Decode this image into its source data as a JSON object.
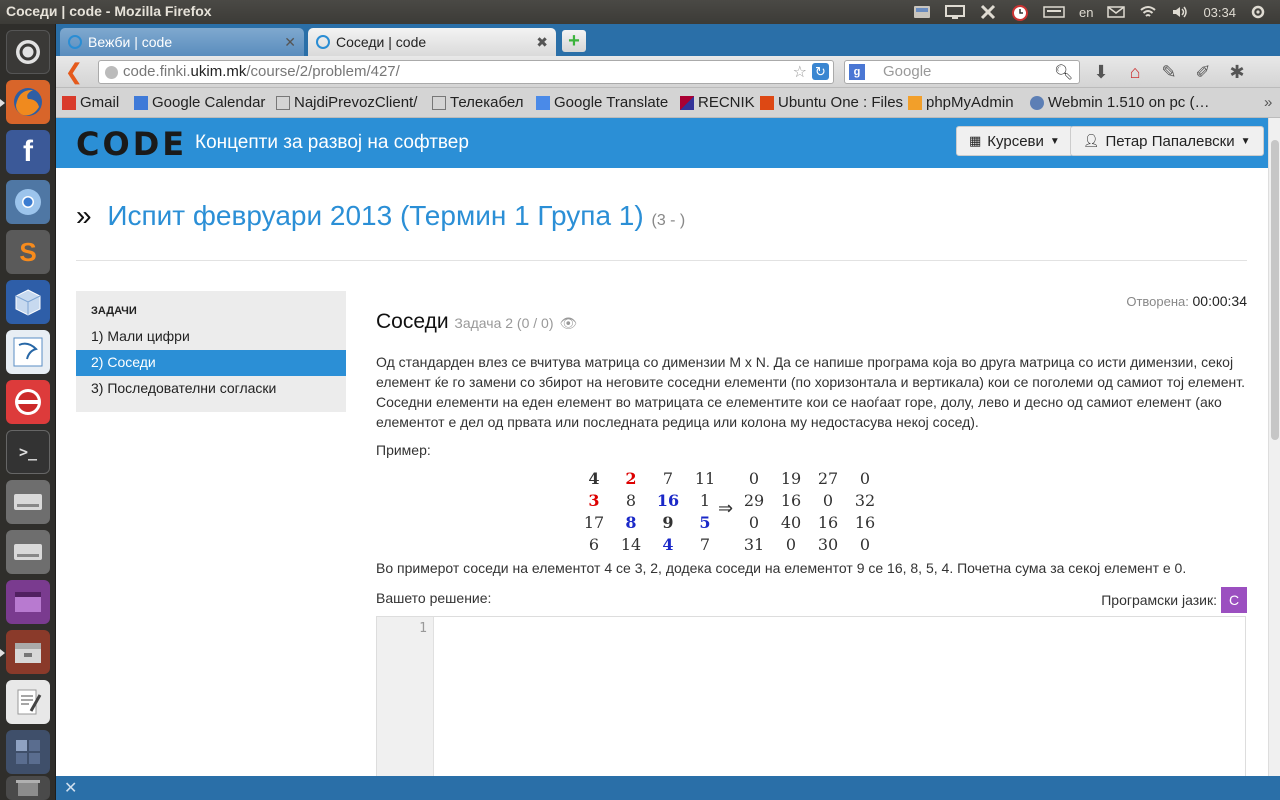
{
  "top_panel": {
    "window_title": "Соседи | code - Mozilla Firefox",
    "keyboard_layout": "en",
    "clock": "03:34"
  },
  "launcher": {
    "items": [
      "ubuntu-icon",
      "firefox-icon",
      "facebook-icon",
      "chromium-icon",
      "sublime-icon",
      "virtualbox-icon",
      "mysql-workbench-icon",
      "eclipse-icon",
      "terminal-icon",
      "drive-icon",
      "drive-icon-2",
      "app-window-icon",
      "file-manager-icon",
      "text-editor-icon",
      "workspace-switcher-icon",
      "trash-icon"
    ]
  },
  "browser": {
    "tabs": [
      {
        "label": "Вежби | code"
      },
      {
        "label": "Соседи | code"
      }
    ],
    "url": {
      "prefix": "code.finki.",
      "host": "ukim.mk",
      "path": "/course/2/problem/427/"
    },
    "search_placeholder": "Google",
    "search_engine_badge": "g",
    "bookmarks": [
      {
        "label": "Gmail"
      },
      {
        "label": "Google Calendar"
      },
      {
        "label": "NajdiPrevozClient/"
      },
      {
        "label": "Телекабел"
      },
      {
        "label": "Google Translate"
      },
      {
        "label": "RECNIK"
      },
      {
        "label": "Ubuntu One : Files"
      },
      {
        "label": "phpMyAdmin"
      },
      {
        "label": "Webmin 1.510 on pc (…"
      }
    ]
  },
  "site": {
    "logo": "CODE",
    "title": "Концепти за развој на софтвер",
    "courses_btn": "Курсеви",
    "user_btn": "Петар Папалевски",
    "page_title": "Испит февруари 2013 (Термин 1 Група 1)",
    "page_title_sub": "(3 - )",
    "sidebar_head": "ЗАДАЧИ",
    "sidebar_items": [
      "1) Мали цифри",
      "2) Соседи",
      "3) Последователни согласки"
    ],
    "opened_label": "Отворена:",
    "opened_time": "00:00:34",
    "problem_title": "Соседи",
    "problem_meta": "Задача 2 (0 / 0)",
    "description": "Од стандарден влез се вчитува матрица со димензии M x N. Да се напише програма која во друга матрица со исти димензии, секој елемент ќе го замени со збирот на неговите соседни елементи (по хоризонтала и вертикала) кои се поголеми од самиот тој елемент. Соседни елементи на еден елемент во матрицата се елементите кои се наоѓаат горе, долу, лево и десно од самиот елемент (ако елементот е дел од првата или последната редица или колона му недостасува некој сосед).",
    "example_label": "Пример:",
    "matrix_in": [
      [
        "4",
        "2",
        "7",
        "11"
      ],
      [
        "3",
        "8",
        "16",
        "1"
      ],
      [
        "17",
        "8",
        "9",
        "5"
      ],
      [
        "6",
        "14",
        "4",
        "7"
      ]
    ],
    "matrix_out": [
      [
        "0",
        "19",
        "27",
        "0"
      ],
      [
        "29",
        "16",
        "0",
        "32"
      ],
      [
        "0",
        "40",
        "16",
        "16"
      ],
      [
        "31",
        "0",
        "30",
        "0"
      ]
    ],
    "arrow": "⇒",
    "note": "Во примерот соседи на елементот 4 се 3, 2, додека соседи на елементот 9 се 16, 8, 5, 4. Почетна сума за секој елемент е 0.",
    "solution_label": "Вашето решение:",
    "language_label": "Програмски јазик:",
    "language_value": "C",
    "editor_line": "1"
  },
  "colors": {
    "accent": "#2b8fd6",
    "tabbar": "#2a6fa8",
    "lang_badge": "#9b4fc0",
    "highlight_red": "#dd0000",
    "highlight_blue": "#1a28c8"
  }
}
